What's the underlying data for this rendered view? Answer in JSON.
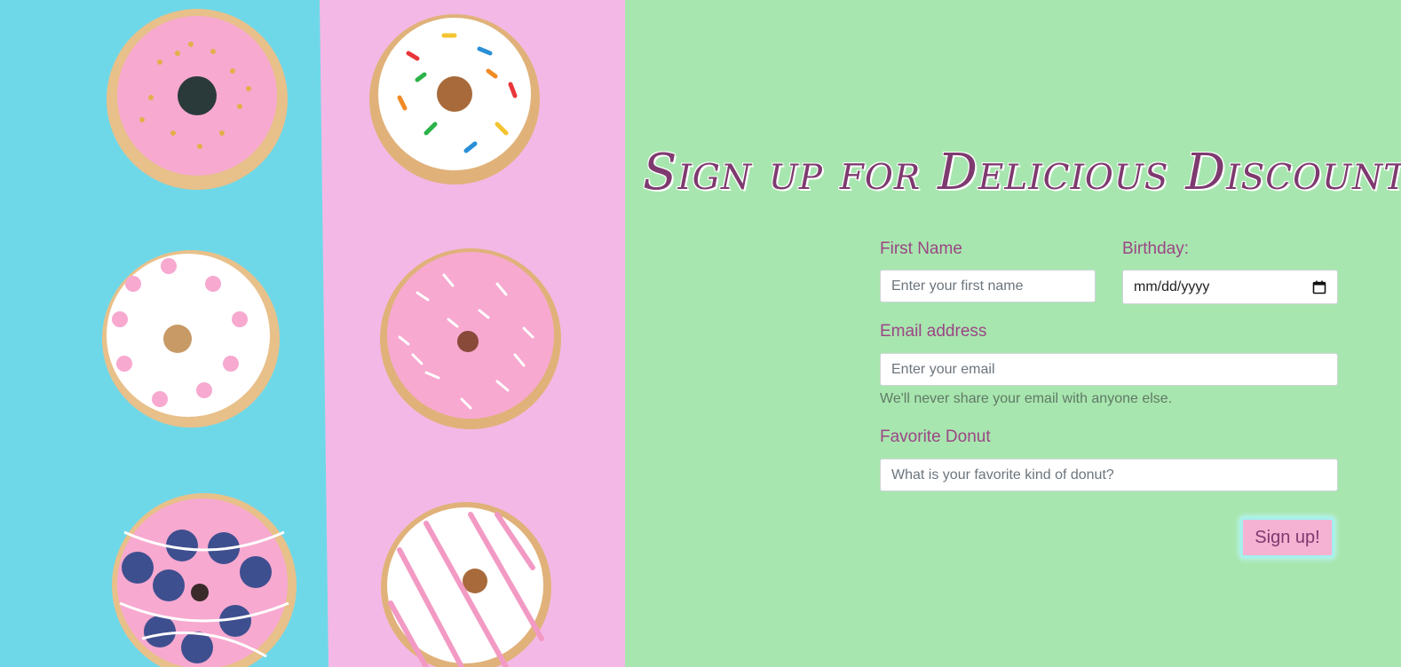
{
  "hero": {
    "image_alt": "six glazed donuts on blue and pink background"
  },
  "form": {
    "title": "Sign up for Delicious Discounts!",
    "first_name": {
      "label": "First Name",
      "placeholder": "Enter your first name"
    },
    "birthday": {
      "label": "Birthday:",
      "placeholder": "mm/dd/yyyy"
    },
    "email": {
      "label": "Email address",
      "placeholder": "Enter your email",
      "help": "We'll never share your email with anyone else."
    },
    "favorite_donut": {
      "label": "Favorite Donut",
      "placeholder": "What is your favorite kind of donut?"
    },
    "submit_label": "Sign up!"
  },
  "colors": {
    "panel_bg": "#a8e6af",
    "left_bg": "#6fd8e8",
    "right_bg": "#f4b8e6",
    "accent": "#9b4685",
    "button_bg": "#f5b2d2"
  }
}
